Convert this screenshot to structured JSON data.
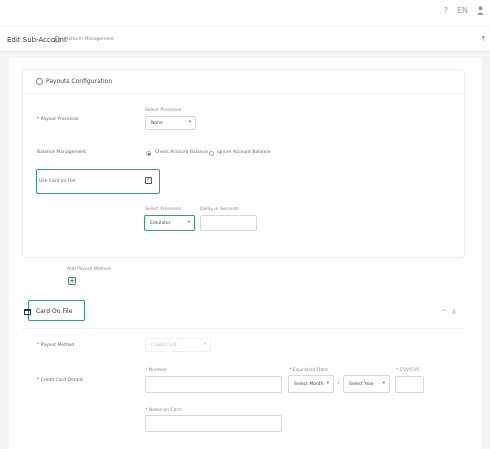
{
  "topbar": {
    "help_icon": "?",
    "language": "EN",
    "user_icon": "user-icon"
  },
  "titlebar": {
    "title": "Edit Sub-Account",
    "breadcrumb": "Platform Management",
    "collapse": "⤒"
  },
  "payouts": {
    "title": "Payouts Configuration",
    "processor_label": "* Payout Processor",
    "processor_caption": "Select Processor",
    "processor_value": "None",
    "balance_label": "Balance Management",
    "radio_check": "Check Account Balance",
    "radio_ignore": "Ignore Account Balance",
    "card_on_file_label": "Use Card on File",
    "card_processor_caption": "Select Processor",
    "card_processor_value": "Emulator",
    "delay_caption": "Delay in Seconds",
    "delay_value": ""
  },
  "add_method": {
    "label": "Add Payout Method",
    "button": "+"
  },
  "cof": {
    "title": "Card On File",
    "up": "^",
    "close": "X",
    "method_label": "* Payout Method",
    "method_value": "Credit Card",
    "details_label": "* Credit Card Details",
    "number_caption": "* Number",
    "exp_caption": "* Expiration Date",
    "cvv_caption": "* CVV/CVC",
    "month_value": "Select Month",
    "slash": "/",
    "year_value": "Select Year",
    "name_caption": "* Name on Card"
  }
}
